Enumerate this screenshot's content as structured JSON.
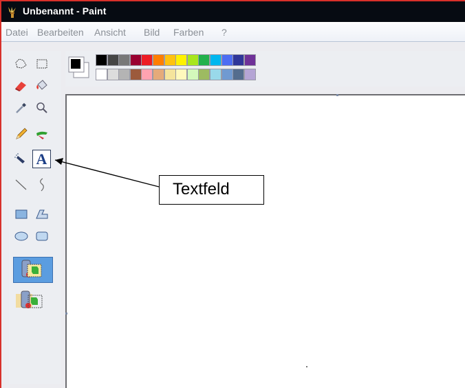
{
  "window": {
    "title": "Unbenannt - Paint"
  },
  "menu": {
    "items": [
      "Datei",
      "Bearbeiten",
      "Ansicht",
      "Bild",
      "Farben",
      "?"
    ]
  },
  "tools": [
    {
      "name": "free-form-select-tool",
      "icon": "lasso-select-icon"
    },
    {
      "name": "select-tool",
      "icon": "rect-select-icon"
    },
    {
      "name": "eraser-tool",
      "icon": "eraser-icon"
    },
    {
      "name": "fill-tool",
      "icon": "paint-bucket-icon"
    },
    {
      "name": "color-picker-tool",
      "icon": "eyedropper-icon"
    },
    {
      "name": "magnifier-tool",
      "icon": "magnifier-icon"
    },
    {
      "name": "pencil-tool",
      "icon": "pencil-icon"
    },
    {
      "name": "brush-tool",
      "icon": "brush-icon"
    },
    {
      "name": "airbrush-tool",
      "icon": "airbrush-icon"
    },
    {
      "name": "text-tool",
      "icon": "text-a-icon",
      "label": "A",
      "selected": true
    },
    {
      "name": "line-tool",
      "icon": "line-icon"
    },
    {
      "name": "curve-tool",
      "icon": "curve-icon"
    },
    {
      "name": "rectangle-tool",
      "icon": "rectangle-icon"
    },
    {
      "name": "polygon-tool",
      "icon": "polygon-icon"
    },
    {
      "name": "ellipse-tool",
      "icon": "ellipse-icon"
    },
    {
      "name": "rounded-rectangle-tool",
      "icon": "rounded-rectangle-icon"
    }
  ],
  "text_options": [
    {
      "name": "opaque-background-option",
      "icon": "opaque-background-icon",
      "selected": true
    },
    {
      "name": "transparent-background-option",
      "icon": "transparent-background-icon",
      "selected": false
    }
  ],
  "colors": {
    "foreground": "#000000",
    "background": "#ffffff",
    "palette_top": [
      "#000000",
      "#464646",
      "#787878",
      "#990030",
      "#ed1c24",
      "#ff7e00",
      "#ffc20e",
      "#fff200",
      "#a8e61d",
      "#22b14c",
      "#00b7ef",
      "#4d6df3",
      "#2f3699",
      "#6f3198"
    ],
    "palette_bottom": [
      "#ffffff",
      "#dcdcdc",
      "#b4b4b4",
      "#9c5a3c",
      "#ffa3b1",
      "#e5aa7a",
      "#f5e49c",
      "#fff9bd",
      "#d3f9bc",
      "#9dbb61",
      "#99d9ea",
      "#709ad1",
      "#546d8e",
      "#b5a5d5"
    ]
  },
  "annotation": {
    "label": "Textfeld"
  }
}
